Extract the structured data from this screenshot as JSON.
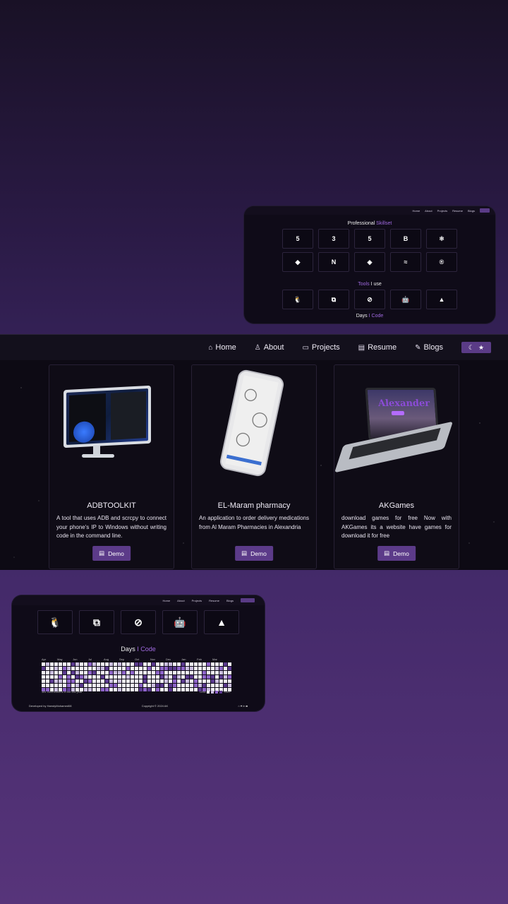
{
  "nav": {
    "home": "Home",
    "about": "About",
    "projects": "Projects",
    "resume": "Resume",
    "blogs": "Blogs",
    "toggle_icons": [
      "☾",
      "★"
    ]
  },
  "mini_top": {
    "skills_title_a": "Professional ",
    "skills_title_b": "Skillset",
    "skills_row1": [
      "html5-icon",
      "css3-icon",
      "html5-icon",
      "bootstrap-icon",
      "react-icon"
    ],
    "skills_row1_glyphs": [
      "5",
      "3",
      "5",
      "B",
      "⚛"
    ],
    "skills_row2": [
      "mongodb-icon",
      "nextjs-icon",
      "git-icon",
      "tailwind-icon",
      "redux-icon"
    ],
    "skills_row2_glyphs": [
      "◆",
      "N",
      "◈",
      "≈",
      "®"
    ],
    "tools_title_a": "Tools",
    "tools_title_b": " I use",
    "tools_glyphs": [
      "🐧",
      "⧉",
      "⊘",
      "🤖",
      "▲"
    ],
    "days_title_a": "Days",
    "days_title_b": " I Code"
  },
  "projects": [
    {
      "title": "ADBTOOLKIT",
      "desc": "A tool that uses ADB and scrcpy to connect your phone's IP to Windows without writing code in the command line.",
      "button": "Demo"
    },
    {
      "title": "EL-Maram pharmacy",
      "desc": "An application to order delivery medications from Al Maram Pharmacies in Alexandria",
      "button": "Demo"
    },
    {
      "title": "AKGames",
      "desc": "download games for free Now with AKGames its a website have games for download it for free",
      "button": "Demo"
    }
  ],
  "mini_bottom": {
    "days_title_a": "Days",
    "days_title_b": " I Code",
    "months": [
      "Apr",
      "May",
      "Jun",
      "Jul",
      "Aug",
      "Sep",
      "Oct",
      "Nov",
      "Dec",
      "Jan",
      "Feb",
      "Mar"
    ],
    "contributions_note": "381 contributions in the last year",
    "legend_less": "Less",
    "legend_more": "More",
    "footer_left": "Developed by HamdyMohamed08",
    "footer_center": "Copyright © 2024 AK",
    "colors": [
      "#f2f0f5",
      "#cbbfe0",
      "#8e64c9",
      "#5b3a8f"
    ]
  }
}
